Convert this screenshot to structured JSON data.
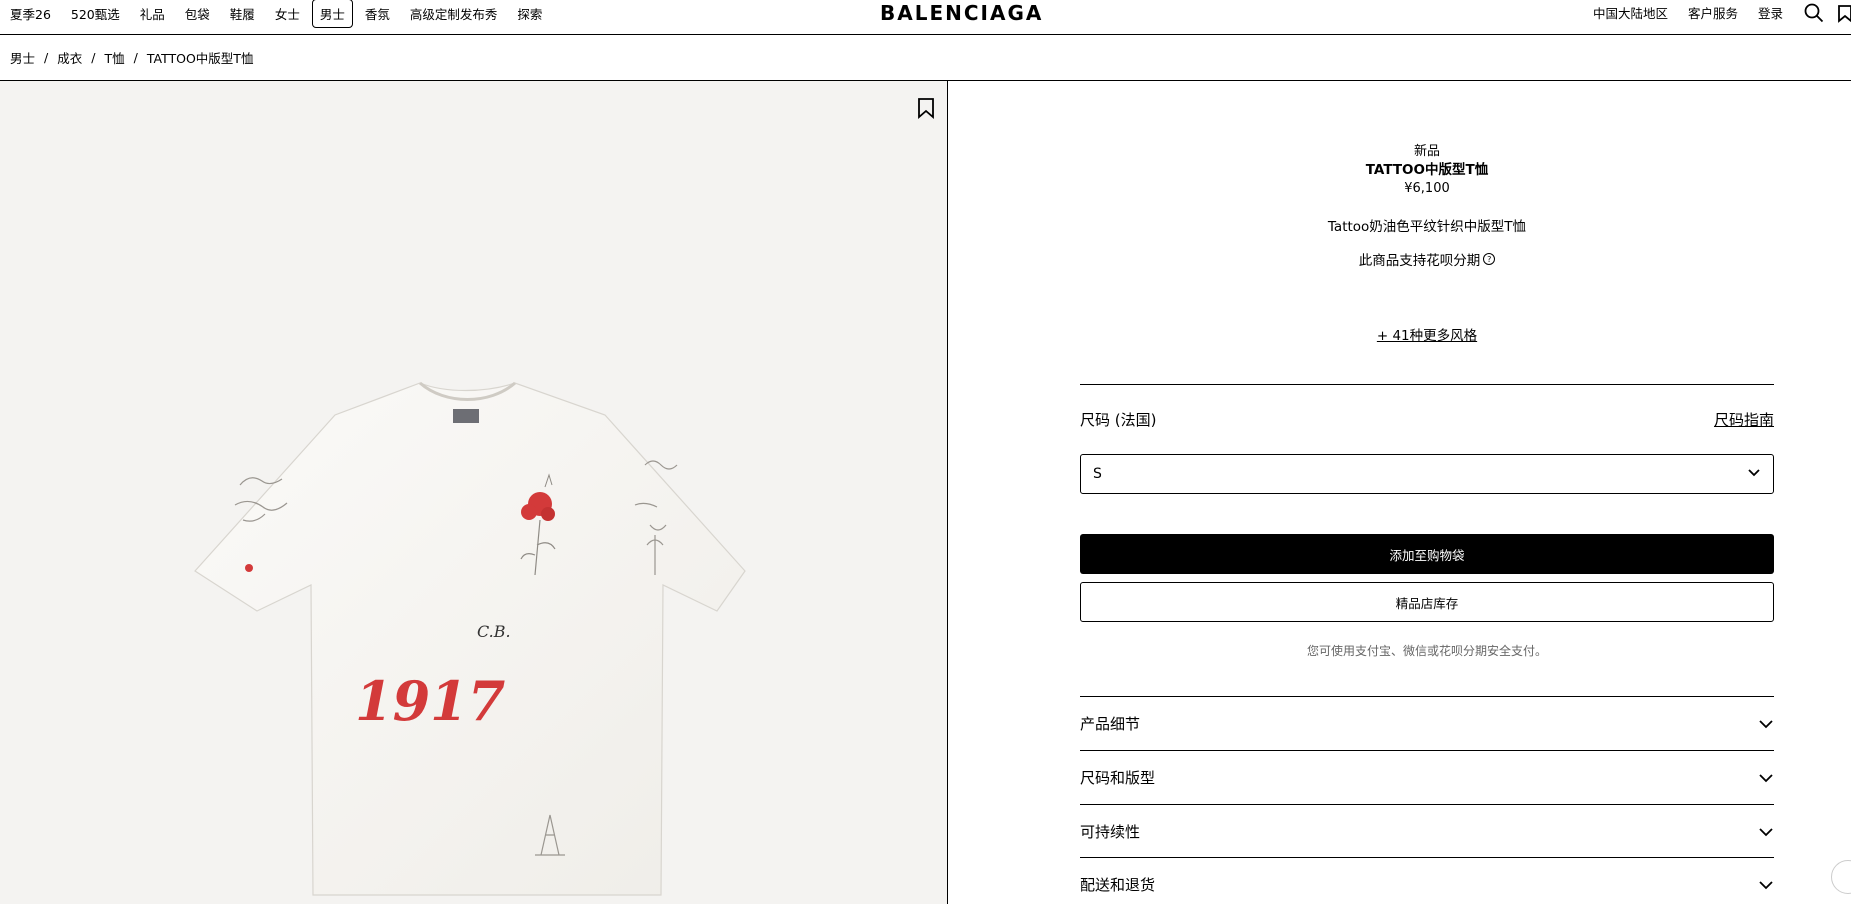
{
  "nav": {
    "items": [
      {
        "label": "夏季26",
        "active": false
      },
      {
        "label": "520甄选",
        "active": false
      },
      {
        "label": "礼品",
        "active": false
      },
      {
        "label": "包袋",
        "active": false
      },
      {
        "label": "鞋履",
        "active": false
      },
      {
        "label": "女士",
        "active": false
      },
      {
        "label": "男士",
        "active": true
      },
      {
        "label": "香氛",
        "active": false
      },
      {
        "label": "高级定制发布秀",
        "active": false
      },
      {
        "label": "探索",
        "active": false
      }
    ],
    "brand": "BALENCIAGA",
    "region": "中国大陆地区",
    "service": "客户服务",
    "login": "登录",
    "icons": [
      "search-icon",
      "bag-icon"
    ]
  },
  "breadcrumb": [
    "男士",
    "成衣",
    "T恤",
    "TATTOO中版型T恤"
  ],
  "product": {
    "image_print": "1917",
    "image_signature": "C.B.",
    "badge": "新品",
    "title": "TATTOO中版型T恤",
    "price": "¥6,100",
    "description": "Tattoo奶油色平纹针织中版型T恤",
    "installment": "此商品支持花呗分期",
    "more_styles": "+ 41种更多风格",
    "size_label": "尺码 (法国)",
    "size_guide": "尺码指南",
    "selected_size": "S",
    "add_to_bag": "添加至购物袋",
    "store_stock": "精品店库存",
    "payment_note": "您可使用支付宝、微信或花呗分期安全支付。",
    "accordion": [
      "产品细节",
      "尺码和版型",
      "可持续性",
      "配送和退货"
    ]
  },
  "colors": {
    "image_bg": "#f4f3f1",
    "print_red": "#d33a3a",
    "text": "#000000"
  }
}
